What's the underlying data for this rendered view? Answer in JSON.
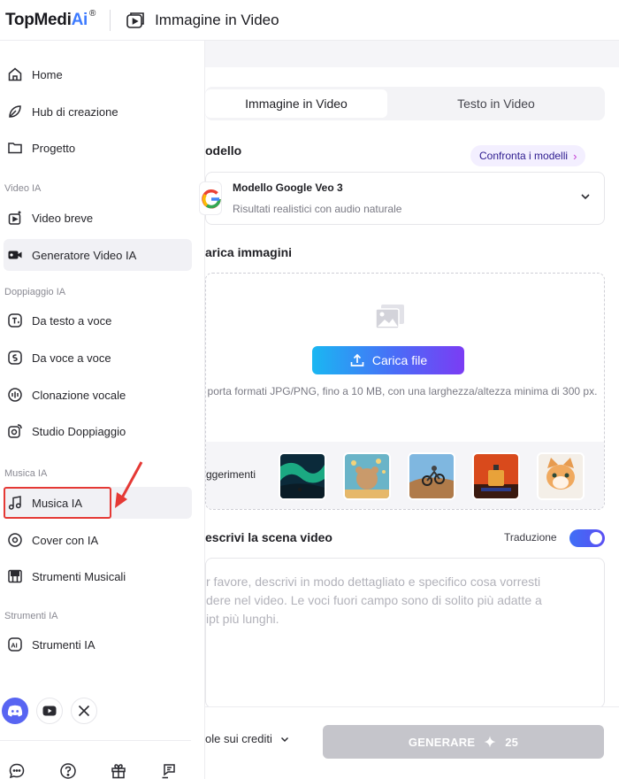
{
  "brand": {
    "name_part1": "TopMedi",
    "name_part2": "Ai",
    "registered": "®",
    "accent": "#3d7bff"
  },
  "header": {
    "title": "Immagine in Video"
  },
  "sidebar": {
    "items": [
      {
        "label": "Home",
        "icon": "home-icon"
      },
      {
        "label": "Hub di creazione",
        "icon": "hub-icon"
      },
      {
        "label": "Progetto",
        "icon": "folder-icon"
      },
      {
        "label": "Video breve",
        "icon": "short-video-icon"
      },
      {
        "label": "Generatore Video IA",
        "icon": "video-camera-icon"
      },
      {
        "label": "Da testo a voce",
        "icon": "text-to-speech-icon"
      },
      {
        "label": "Da voce a voce",
        "icon": "voice-to-voice-icon"
      },
      {
        "label": "Clonazione vocale",
        "icon": "voice-clone-icon"
      },
      {
        "label": "Studio Doppiaggio",
        "icon": "dubbing-studio-icon"
      },
      {
        "label": "Musica IA",
        "icon": "music-note-icon"
      },
      {
        "label": "Cover con IA",
        "icon": "vinyl-icon"
      },
      {
        "label": "Strumenti Musicali",
        "icon": "piano-icon"
      },
      {
        "label": "Strumenti IA",
        "icon": "ai-tools-icon"
      }
    ],
    "sections": [
      "Video IA",
      "Doppiaggio IA",
      "Musica IA",
      "Strumenti IA"
    ],
    "active_item": "Generatore Video IA",
    "socials": [
      "discord-icon",
      "youtube-icon",
      "x-icon"
    ],
    "footer_icons": [
      "chat-icon",
      "help-icon",
      "gift-icon",
      "feedback-icon"
    ]
  },
  "main": {
    "tabs": [
      {
        "label": "Immagine in Video",
        "active": true
      },
      {
        "label": "Testo in Video",
        "active": false
      }
    ],
    "model_section": {
      "title": "odello",
      "compare_label": "Confronta i modelli",
      "compare_chevron": "›",
      "model_name": "Modello Google Veo 3",
      "model_desc": "Risultati realistici con audio naturale"
    },
    "upload_section": {
      "title": "arica immagini",
      "button_label": "Carica file",
      "hint": "porta formati JPG/PNG, fino a 10 MB, con una larghezza/altezza minima di 300 px.",
      "suggestions_label": "ggerimenti"
    },
    "scene_section": {
      "title": "escrivi la scena video",
      "toggle_label": "Traduzione",
      "toggle_on": true,
      "placeholder": "r favore, descrivi in modo dettagliato e specifico cosa vorresti\ndere nel video. Le voci fuori campo sono di solito più adatte a\nipt più lunghi."
    },
    "bottom": {
      "credit_label": "ole sui crediti",
      "generate_label": "GENERARE",
      "generate_cost": "25"
    }
  }
}
